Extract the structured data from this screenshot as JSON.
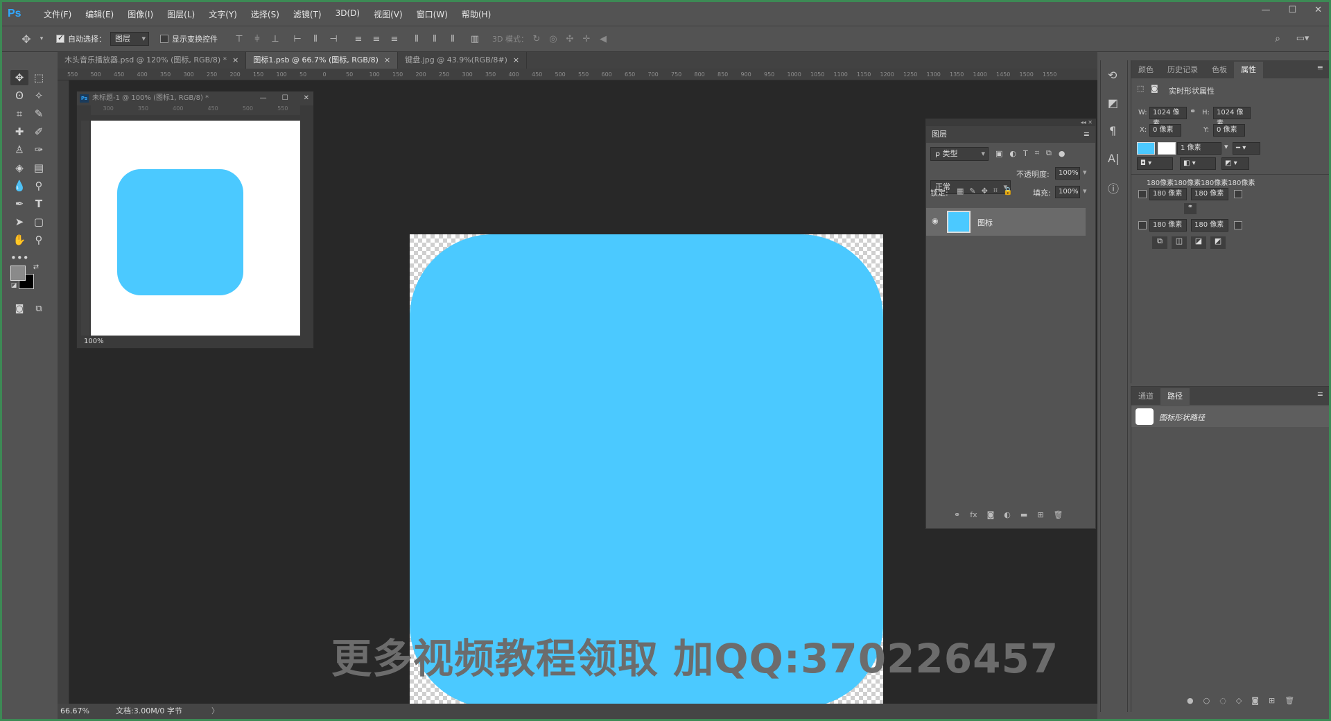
{
  "app": {
    "logo": "Ps",
    "menus": [
      "文件(F)",
      "编辑(E)",
      "图像(I)",
      "图层(L)",
      "文字(Y)",
      "选择(S)",
      "滤镜(T)",
      "3D(D)",
      "视图(V)",
      "窗口(W)",
      "帮助(H)"
    ],
    "window_controls": [
      "—",
      "☐",
      "✕"
    ]
  },
  "options": {
    "auto_select_label": "自动选择：",
    "auto_select_value": "图层",
    "show_transform_label": "显示变换控件",
    "mode_3d": "3D 模式："
  },
  "tabs": [
    {
      "label": "木头音乐播放器.psd @ 120% (图标, RGB/8) *",
      "active": false
    },
    {
      "label": "图标1.psb @ 66.7% (图标, RGB/8)",
      "active": true
    },
    {
      "label": "键盘.jpg @ 43.9%(RGB/8#)",
      "active": false
    }
  ],
  "ruler": {
    "h_labels": [
      "550",
      "500",
      "450",
      "400",
      "350",
      "300",
      "250",
      "200",
      "150",
      "100",
      "50",
      "0",
      "50",
      "100",
      "150",
      "200",
      "250",
      "300",
      "350",
      "400",
      "450",
      "500",
      "550",
      "600",
      "650",
      "700",
      "750",
      "800",
      "850",
      "900",
      "950",
      "1000",
      "1050",
      "1100",
      "1150",
      "1200",
      "1250",
      "1300",
      "1350",
      "1400",
      "1450",
      "1500",
      "1550"
    ]
  },
  "float_doc": {
    "title": "未标题-1 @ 100% (图标1, RGB/8) *",
    "zoom": "100%",
    "ruler": [
      "300",
      "350",
      "400",
      "450",
      "500",
      "550"
    ]
  },
  "watermark": "更多视频教程领取 加QQ:370226457",
  "layers": {
    "tab": "图层",
    "filter": "ρ 类型",
    "blend": "正常",
    "opacity_label": "不透明度:",
    "opacity": "100%",
    "lock_label": "锁定:",
    "fill_label": "填充:",
    "fill": "100%",
    "layer_name": "图标"
  },
  "properties": {
    "tabs": [
      "颜色",
      "历史记录",
      "色板",
      "属性"
    ],
    "title": "实时形状属性",
    "w_label": "W:",
    "w": "1024 像素",
    "h_label": "H:",
    "h": "1024 像素",
    "x_label": "X:",
    "x": "0 像素",
    "y_label": "Y:",
    "y": "0 像素",
    "stroke_width": "1 像素",
    "corners_all": "180像素180像素180像素180像素",
    "corner": "180 像素"
  },
  "paths": {
    "tabs": [
      "通道",
      "路径"
    ],
    "item": "图标形状路径"
  },
  "status": {
    "zoom": "66.67%",
    "doc": "文档:3.00M/0 字节"
  },
  "colors": {
    "shape": "#4bc9ff",
    "accent": "#31a8ff"
  }
}
